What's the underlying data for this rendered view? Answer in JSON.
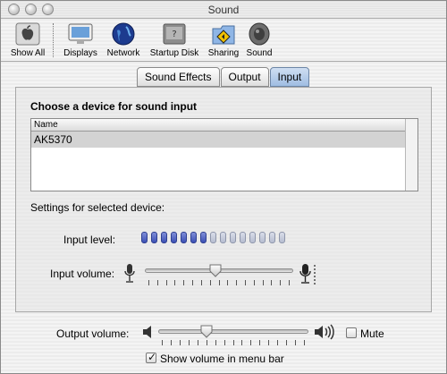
{
  "window": {
    "title": "Sound"
  },
  "toolbar": {
    "items": [
      {
        "label": "Show All",
        "icon": "apple-icon"
      },
      {
        "label": "Displays",
        "icon": "display-icon"
      },
      {
        "label": "Network",
        "icon": "globe-icon"
      },
      {
        "label": "Startup Disk",
        "icon": "hard-disk-icon"
      },
      {
        "label": "Sharing",
        "icon": "sharing-folder-icon"
      },
      {
        "label": "Sound",
        "icon": "speaker-icon"
      }
    ]
  },
  "tabs": [
    {
      "label": "Sound Effects",
      "active": false
    },
    {
      "label": "Output",
      "active": false
    },
    {
      "label": "Input",
      "active": true
    }
  ],
  "input": {
    "choose_label": "Choose a device for sound input",
    "list": {
      "header": "Name",
      "rows": [
        "AK5370"
      ],
      "selected_row": 0
    },
    "settings_label": "Settings for selected device:",
    "level_label": "Input level:",
    "level": {
      "segments": 15,
      "active": 7
    },
    "volume_label": "Input volume:",
    "volume_value": 0.47
  },
  "output": {
    "volume_label": "Output volume:",
    "volume_value": 0.3,
    "mute_label": "Mute",
    "mute_checked": false,
    "menu_bar_label": "Show volume in menu bar",
    "menu_bar_checked": true
  },
  "colors": {
    "level_on": "#3b4fb3",
    "level_off": "#b6bdd0",
    "tab_active": "#9fbde2"
  }
}
